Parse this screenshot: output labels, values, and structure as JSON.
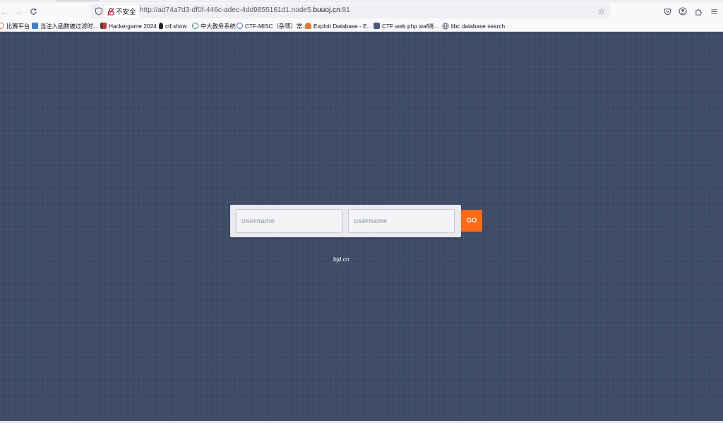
{
  "browser": {
    "security_label": "不安全",
    "url_prefix": "http://",
    "url_subdomain": "ad74a7d3-df0f-446c-adec-4dd9855161d1.node5.",
    "url_host": "buuoj.cn",
    "url_port": ":81"
  },
  "bookmarks": [
    {
      "label": "比赛平台",
      "icon": "platform-icon",
      "color": "#e8772e"
    },
    {
      "label": "当注入函数被过滤时...",
      "icon": "csdn-icon",
      "color": "#3b7fd4"
    },
    {
      "label": "Hackergame 2024",
      "icon": "hackergame-icon",
      "color": "#c23b3b"
    },
    {
      "label": "ctf.show",
      "icon": "ctfshow-icon",
      "color": "#222222"
    },
    {
      "label": "中大教务系统",
      "icon": "sysu-icon",
      "color": "#2e8b57"
    },
    {
      "label": "CTF-MISC（杂项）常...",
      "icon": "ctf-misc-icon",
      "color": "#2b6fd6"
    },
    {
      "label": "Exploit Database - E...",
      "icon": "exploitdb-icon",
      "color": "#e8772e"
    },
    {
      "label": "CTF web php waf绕...",
      "icon": "ctf-web-icon",
      "color": "#4a5a7a"
    },
    {
      "label": "libc database search",
      "icon": "globe-icon",
      "color": "#5b5b66"
    }
  ],
  "form": {
    "username_placeholder": "username",
    "password_placeholder": "username",
    "go_label": "GO"
  },
  "footer": {
    "text": "bjd.cn"
  },
  "colors": {
    "page_background": "#3d4b66",
    "go_button": "#ff6a13",
    "form_panel": "#e9eaee"
  }
}
